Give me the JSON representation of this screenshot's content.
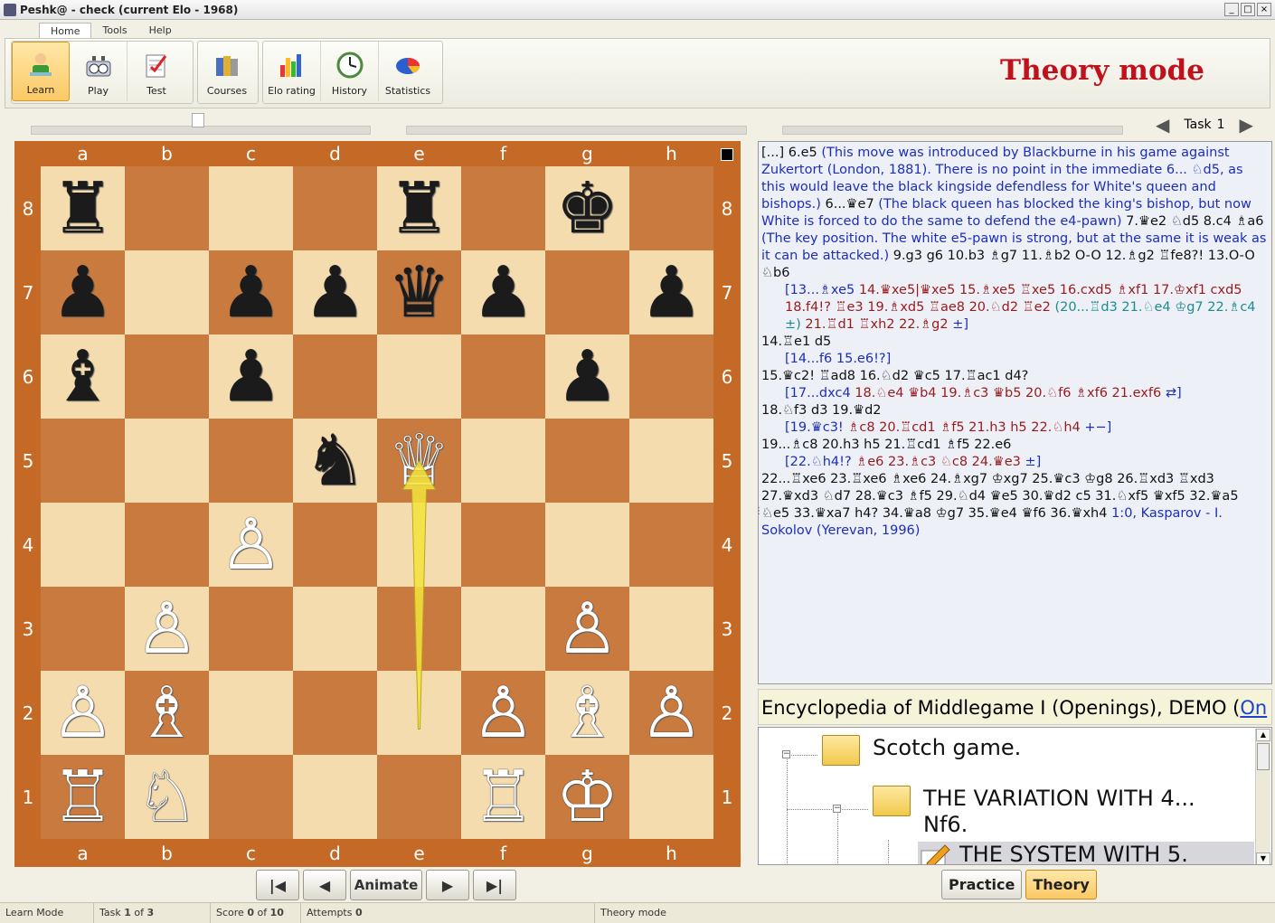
{
  "window": {
    "title": "Peshk@ -  check (current Elo - 1968)"
  },
  "ribbon": {
    "tabs": [
      "Home",
      "Tools",
      "Help"
    ],
    "buttons": {
      "learn": "Learn",
      "play": "Play",
      "test": "Test",
      "courses": "Courses",
      "elo_rating": "Elo rating",
      "history": "History",
      "statistics": "Statistics"
    },
    "mode_title": "Theory mode"
  },
  "task_nav": {
    "label": "Task",
    "number": "1"
  },
  "board": {
    "files": [
      "a",
      "b",
      "c",
      "d",
      "e",
      "f",
      "g",
      "h"
    ],
    "ranks": [
      "8",
      "7",
      "6",
      "5",
      "4",
      "3",
      "2",
      "1"
    ],
    "pieces": {
      "a8": "♜",
      "e8": "♜",
      "g8": "♚",
      "a7": "♟",
      "c7": "♟",
      "d7": "♟",
      "e7": "♛",
      "f7": "♟",
      "h7": "♟",
      "a6": "♝",
      "c6": "♟",
      "g6": "♟",
      "d5": "♞",
      "e5": "♕",
      "c4": "♙",
      "b3": "♙",
      "g3": "♙",
      "a2": "♙",
      "b2": "♗",
      "f2": "♙",
      "g2": "♗",
      "h2": "♙",
      "a1": "♖",
      "b1": "♘",
      "f1": "♖",
      "g1": "♔"
    },
    "highlight_arrow": {
      "from": "e2",
      "to": "e5",
      "color": "#f3e33c"
    }
  },
  "board_controls": {
    "first": "|◀",
    "prev": "◀",
    "animate": "Animate",
    "next": "▶",
    "last": "▶|"
  },
  "notation": [
    {
      "cls": "c-main",
      "text": "[...] 6.e5 "
    },
    {
      "cls": "c-comment",
      "text": "(This move was introduced by Blackburne in his game against Zukertort (London, 1881). There is no point in the immediate 6... ♘d5, as this would leave the black kingside defendless for  White's queen and bishops.)"
    },
    {
      "cls": "c-main",
      "text": " 6...♛e7 "
    },
    {
      "cls": "c-comment",
      "text": "(The black queen has blocked the king's bishop, but now White is forced to do the same to defend the e4-pawn)"
    },
    {
      "cls": "c-main",
      "text": " 7.♛e2 ♘d5 8.c4 ♗a6 "
    },
    {
      "cls": "c-comment",
      "text": "(The key position. The white e5-pawn is strong, but at the same it is weak as it can be attacked.)"
    },
    {
      "cls": "c-main",
      "text": " 9.g3 g6 10.b3 ♗g7 11.♗b2 O-O 12.♗g2 ♖fe8?! 13.O-O ♘b6"
    }
  ],
  "notation_lines": [
    {
      "indent": true,
      "parts": [
        {
          "cls": "c-comment",
          "text": "[13...♗xe5 "
        },
        {
          "cls": "c-var2",
          "text": "14.♛xe5|♛xe5 15.♗xe5 ♖xe5 16.cxd5 ♗xf1 17.♔xf1 cxd5 18.f4!? ♖e3 19.♗xd5 ♖ae8 20.♘d2 ♖e2 "
        },
        {
          "cls": "c-teal",
          "text": "(20...♖d3 21.♘e4 ♔g7 22.♗c4 ±)"
        },
        {
          "cls": "c-var2",
          "text": " 21.♖d1 ♖xh2 22.♗g2 "
        },
        {
          "cls": "c-comment",
          "text": "±]"
        }
      ]
    },
    {
      "indent": false,
      "parts": [
        {
          "cls": "c-main",
          "text": "14.♖e1 d5"
        }
      ]
    },
    {
      "indent": true,
      "parts": [
        {
          "cls": "c-comment",
          "text": "[14...f6 15.e6!?]"
        }
      ]
    },
    {
      "indent": false,
      "parts": [
        {
          "cls": "c-main",
          "text": "15.♛c2! ♖ad8 16.♘d2 ♛c5 17.♖ac1 d4?"
        }
      ]
    },
    {
      "indent": true,
      "parts": [
        {
          "cls": "c-comment",
          "text": "[17...dxc4 "
        },
        {
          "cls": "c-var2",
          "text": "18.♘e4 ♛b4 19.♗c3 ♛b5 20.♘f6 ♗xf6 21.exf6 "
        },
        {
          "cls": "c-comment",
          "text": "⇄]"
        }
      ]
    },
    {
      "indent": false,
      "parts": [
        {
          "cls": "c-main",
          "text": "18.♘f3 d3 19.♛d2"
        }
      ]
    },
    {
      "indent": true,
      "parts": [
        {
          "cls": "c-comment",
          "text": "[19.♛c3! "
        },
        {
          "cls": "c-var2",
          "text": "♗c8 20.♖cd1 ♗f5 21.h3 h5 22.♘h4 "
        },
        {
          "cls": "c-comment",
          "text": "+−]"
        }
      ]
    },
    {
      "indent": false,
      "parts": [
        {
          "cls": "c-main",
          "text": "19...♗c8 20.h3 h5 21.♖cd1 ♗f5 22.e6"
        }
      ]
    },
    {
      "indent": true,
      "parts": [
        {
          "cls": "c-comment",
          "text": "[22.♘h4!? "
        },
        {
          "cls": "c-var2",
          "text": "♗e6 23.♗c3 ♘c8 24.♛e3 "
        },
        {
          "cls": "c-comment",
          "text": "±]"
        }
      ]
    },
    {
      "indent": false,
      "parts": [
        {
          "cls": "c-main",
          "text": "22...♖xe6 23.♖xe6 ♗xe6 24.♗xg7 ♔xg7 25.♛c3 ♔g8 26.♖xd3 ♖xd3 27.♛xd3 ♘d7 28.♛c3 ♗f5 29.♘d4 ♛e5 30.♛d2 c5 31.♘xf5 ♛xf5 32.♛a5 ♘e5 33.♛xa7 h4? 34.♛a8 ♔g7 35.♛e4 ♛f6 36.♛xh4 "
        },
        {
          "cls": "c-comment",
          "text": "1:0, Kasparov - I. Sokolov (Yerevan, 1996)"
        }
      ]
    }
  ],
  "encyclopedia": {
    "title": "Encyclopedia of Middlegame I (Openings), DEMO (",
    "link": "On",
    "tree": [
      "Scotch game.",
      "THE VARIATION WITH 4... Nf6.",
      "THE SYSTEM WITH 5."
    ]
  },
  "mode_buttons": {
    "practice": "Practice",
    "theory": "Theory"
  },
  "status": {
    "mode": "Learn Mode",
    "task_label": "Task",
    "task_current": "1",
    "task_of": "of",
    "task_total": "3",
    "score_label": "Score",
    "score_current": "0",
    "score_of": "of",
    "score_total": "10",
    "attempts_label": "Attempts",
    "attempts_value": "0",
    "right": "Theory mode"
  }
}
